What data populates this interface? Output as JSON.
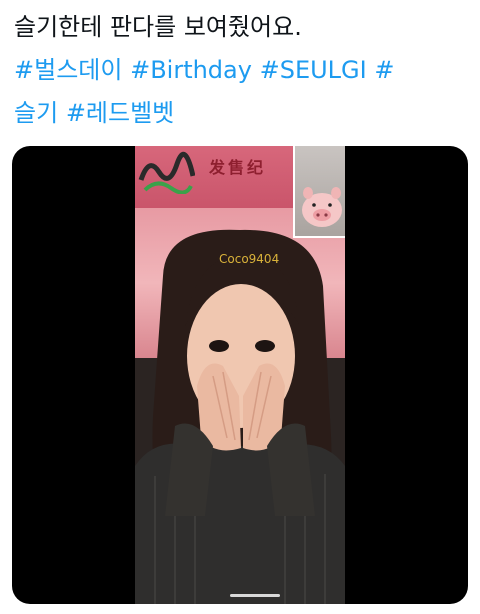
{
  "tweet": {
    "line1": "슬기한테 판다를 보여줬어요.",
    "line2_tags": [
      "#벌스데이",
      "#Birthday",
      "#SEULGI",
      "#"
    ],
    "line3_tags": [
      "슬기",
      "#레드벨벳"
    ]
  },
  "video": {
    "sign_text": "发售纪",
    "username": "Coco9404"
  },
  "icons": {
    "pip": "pig-plush-icon",
    "home": "home-indicator"
  },
  "colors": {
    "text": "#0f1419",
    "hashtag": "#1d9bf0",
    "media_bg": "#000000",
    "username": "#d9b23a"
  }
}
